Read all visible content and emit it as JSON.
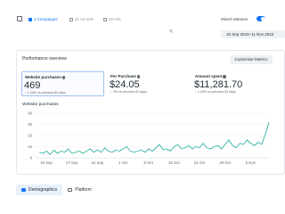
{
  "header": {
    "breadcrumbs": [
      {
        "label": "2 Campaigns",
        "active": true
      },
      {
        "label": "21 Ad sets",
        "active": false
      },
      {
        "label": "40 Ads",
        "active": false
      }
    ],
    "mixed_label": "Mixed statuses",
    "date_range": "10 Sep 2023–11 Nov 2023"
  },
  "overview": {
    "title": "Performance overview",
    "customise_label": "Customise Metrics",
    "metrics": [
      {
        "label": "Website purchases",
        "value": "469",
        "delta": "↑ 1.24% vs previous 63 days"
      },
      {
        "label": "Per Purchase",
        "value": "$24.05",
        "delta": "↑ 3% vs previous 63 days"
      },
      {
        "label": "Amount spent",
        "value": "$11,281.70",
        "delta": "↑ 1.24% vs previous 63 days"
      }
    ]
  },
  "chart_data": {
    "type": "line",
    "title": "Website purchases",
    "xlabel": "",
    "ylabel": "",
    "ylim": [
      0,
      40
    ],
    "yticks": [
      0,
      10,
      20,
      30,
      40
    ],
    "xtick_labels": [
      "10 Sep",
      "17 Sep",
      "24 Sep",
      "1 Oct",
      "8 Oct",
      "15 Oct",
      "22 Oct",
      "29 Oct",
      "5 Nov"
    ],
    "grid": true,
    "color": "#2fb3a3",
    "series": [
      {
        "values": [
          5,
          4,
          6,
          3,
          7,
          4,
          6,
          5,
          8,
          4,
          5,
          6,
          4,
          6,
          8,
          5,
          7,
          5,
          9,
          6,
          5,
          7,
          6,
          8,
          10,
          6,
          5,
          6,
          7,
          5,
          8,
          6,
          9,
          12,
          7,
          8,
          6,
          10,
          12,
          8,
          9,
          11,
          8,
          10,
          9,
          13,
          9,
          8,
          10,
          11,
          8,
          12,
          16,
          11,
          9,
          13,
          12,
          16,
          13,
          11,
          14,
          12,
          21,
          32
        ]
      }
    ]
  },
  "tabs": [
    {
      "label": "Demographics",
      "active": true
    },
    {
      "label": "Platform",
      "active": false
    }
  ],
  "icons": {
    "panel": "panel-toggle-icon",
    "campaign": "folder-icon",
    "adset": "grid-icon",
    "ad": "ad-icon",
    "info": "info-icon",
    "demographics": "people-icon",
    "platform": "platform-icon"
  }
}
